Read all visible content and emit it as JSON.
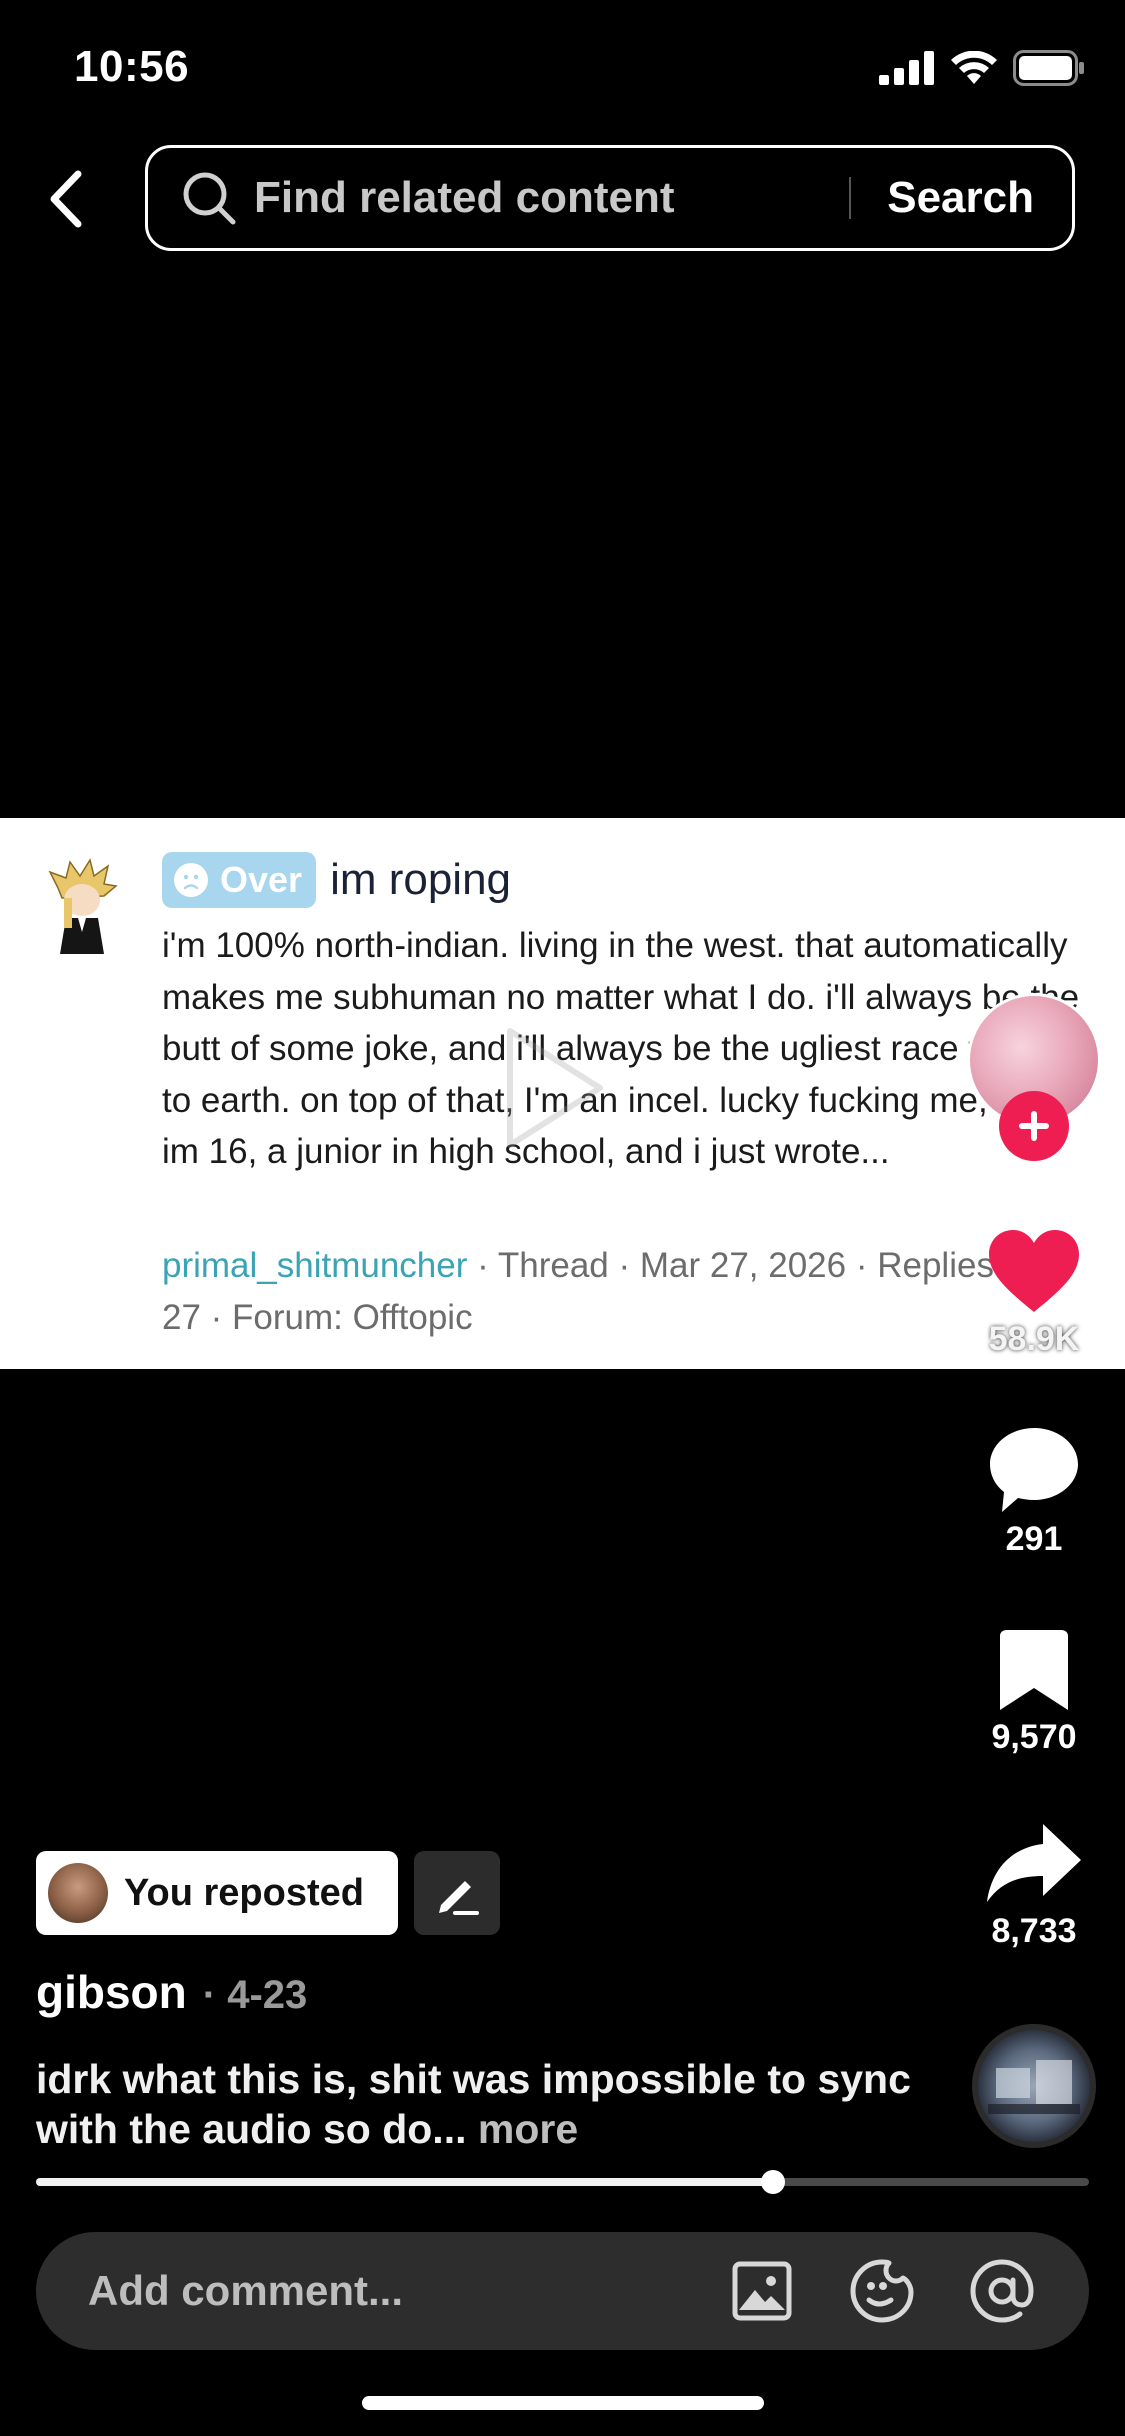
{
  "status_bar": {
    "time": "10:56"
  },
  "search": {
    "placeholder": "Find related content",
    "button_label": "Search"
  },
  "post": {
    "badge_label": "Over",
    "title": "im roping",
    "body": "i'm 100% north-indian. living in the west. that automatically makes me subhuman no matter what I do. i'll always be the butt of some joke, and i'll always be the ugliest race to walk to earth. on top of that, I'm an incel. lucky fucking me, right. im 16, a junior in high school, and i just wrote...",
    "username": "primal_shitmuncher",
    "meta": " · Thread · Mar 27, 2026 · Replies: 27 · Forum: Offtopic"
  },
  "actions": {
    "likes": "58.9K",
    "comments": "291",
    "bookmarks": "9,570",
    "shares": "8,733"
  },
  "repost": {
    "label": "You reposted"
  },
  "author": {
    "name": "gibson",
    "date": "· 4-23"
  },
  "caption": {
    "text": "idrk what this is, shit was impossible to sync with the audio so do...",
    "more": " more"
  },
  "playback": {
    "progress": 0.7
  },
  "comment": {
    "placeholder": "Add comment..."
  },
  "colors": {
    "like": "#ee1d52",
    "badge": "#a7d6ee",
    "post_username": "#3aa3b4"
  }
}
